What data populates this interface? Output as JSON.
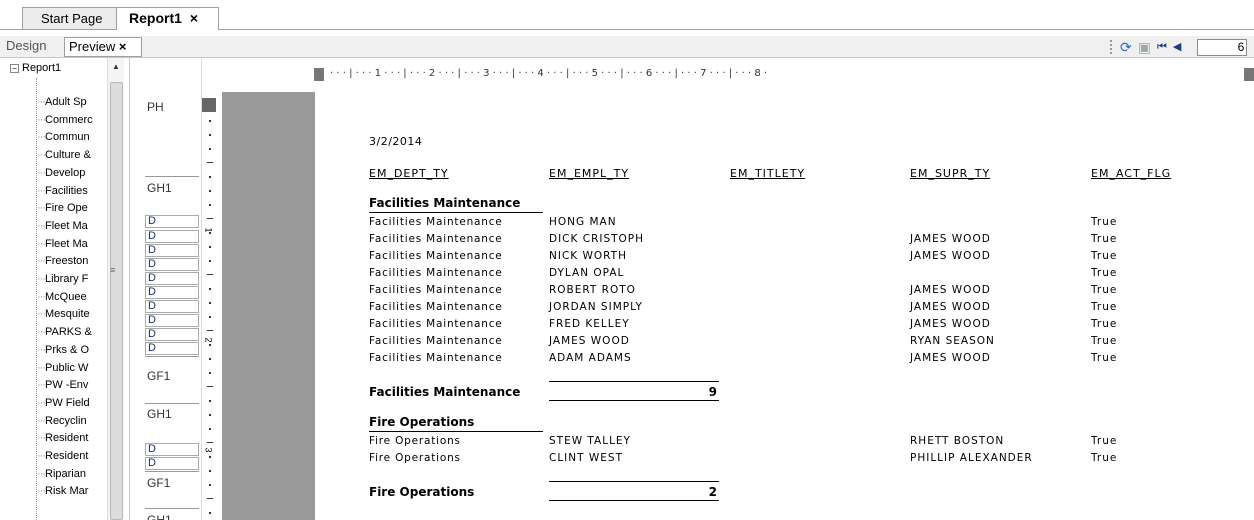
{
  "tabs": {
    "start_page": "Start Page",
    "report": "Report1",
    "close": "×"
  },
  "subtabs": {
    "design": "Design",
    "preview": "Preview",
    "close": "×"
  },
  "toolbar": {
    "page_value": "6"
  },
  "tree": {
    "root": "Report1",
    "toggle": "−",
    "items": [
      "Adult Sp",
      "Commerc",
      "Commun",
      "Culture &",
      "Develop",
      "Facilities",
      "Fire Ope",
      "Fleet Ma",
      "Fleet Ma",
      "Freeston",
      "Library F",
      "McQuee",
      "Mesquite",
      "PARKS &",
      "Prks & O",
      "Public W",
      "PW -Env",
      "PW Field",
      "Recyclin",
      "Resident",
      "Resident",
      "Riparian",
      "Risk Mar"
    ]
  },
  "bands": {
    "ph": "PH",
    "gh1": "GH1",
    "gf1": "GF1",
    "d": "D"
  },
  "ruler": {
    "h": "·  ·  ·  |  ·  ·  ·  1  ·  ·  ·  |  ·  ·  ·  2  ·  ·  ·  |  ·  ·  ·  3  ·  ·  ·  |  ·  ·  ·  4  ·  ·  ·  |  ·  ·  ·  5  ·  ·  ·  |  ·  ·  ·  6  ·  ·  ·  |  ·  ·  ·  7  ·  ·  ·  |  ·  ·  ·  8  ·",
    "v1": "1",
    "v2": "2",
    "v3": "3"
  },
  "report": {
    "date": "3/2/2014",
    "columns": [
      "EM_DEPT_TY",
      "EM_EMPL_TY",
      "EM_TITLETY",
      "EM_SUPR_TY",
      "EM_ACT_FLG"
    ],
    "groups": [
      {
        "title": "Facilities Maintenance",
        "rows": [
          [
            "Facilities Maintenance",
            "HONG MAN",
            "",
            "True"
          ],
          [
            "Facilities Maintenance",
            "DICK CRISTOPH",
            "JAMES WOOD",
            "True"
          ],
          [
            "Facilities Maintenance",
            "NICK WORTH",
            "JAMES WOOD",
            "True"
          ],
          [
            "Facilities Maintenance",
            "DYLAN OPAL",
            "",
            "True"
          ],
          [
            "Facilities Maintenance",
            "ROBERT ROTO",
            "JAMES WOOD",
            "True"
          ],
          [
            "Facilities Maintenance",
            "JORDAN SIMPLY",
            "JAMES WOOD",
            "True"
          ],
          [
            "Facilities Maintenance",
            "FRED KELLEY",
            "JAMES WOOD",
            "True"
          ],
          [
            "Facilities Maintenance",
            "JAMES WOOD",
            "RYAN SEASON",
            "True"
          ],
          [
            "Facilities Maintenance",
            "ADAM ADAMS",
            "JAMES WOOD",
            "True"
          ]
        ],
        "footer": "Facilities Maintenance",
        "count": "9"
      },
      {
        "title": "Fire Operations",
        "rows": [
          [
            "Fire Operations",
            "STEW TALLEY",
            "RHETT BOSTON",
            "True"
          ],
          [
            "Fire Operations",
            "CLINT WEST",
            "PHILLIP ALEXANDER",
            "True"
          ]
        ],
        "footer": "Fire Operations",
        "count": "2"
      }
    ]
  }
}
